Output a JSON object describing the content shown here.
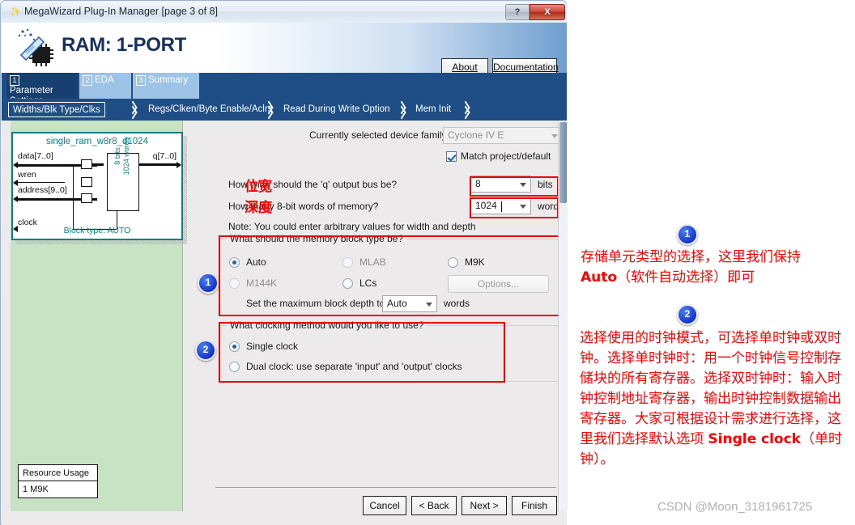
{
  "window": {
    "title": "MegaWizard Plug-In Manager [page 3 of 8]",
    "title_icon": "wand-icon",
    "help_label": "?",
    "close_label": "X"
  },
  "header": {
    "title": "RAM: 1-PORT",
    "logo_icon": "chip-wizard-icon",
    "about_label": "About",
    "documentation_label": "Documentation"
  },
  "tabs": [
    {
      "num": "1",
      "label": "Parameter Settings",
      "active": true
    },
    {
      "num": "2",
      "label": "EDA",
      "active": false
    },
    {
      "num": "3",
      "label": "Summary",
      "active": false
    }
  ],
  "breadcrumbs": [
    {
      "label": "Widths/Blk Type/Clks",
      "selected": true
    },
    {
      "label": "Regs/Clken/Byte Enable/Aclrs",
      "selected": false
    },
    {
      "label": "Read During Write Option",
      "selected": false
    },
    {
      "label": "Mem Init",
      "selected": false
    }
  ],
  "diagram": {
    "title": "single_ram_w8r8_d1024",
    "inputs": [
      "data[7..0]",
      "wren",
      "address[9..0]",
      "clock"
    ],
    "output": "q[7..0]",
    "core_text": "8 bits\n1024 words",
    "block_type": "Block type: AUTO"
  },
  "resource_usage": {
    "header": "Resource Usage",
    "value": "1 M9K"
  },
  "form": {
    "device_family_label": "Currently selected device family:",
    "device_family_value": "Cyclone IV E",
    "match_project_label": "Match project/default",
    "match_project_checked": true,
    "q_width_label": "How wide should the 'q' output bus be?",
    "q_width_value": "8",
    "q_width_unit": "bits",
    "depth_label": "How many 8-bit words of memory?",
    "depth_value": "1024",
    "depth_unit": "words",
    "note": "Note: You could enter arbitrary values for width and depth"
  },
  "block_type_group": {
    "title": "What should the memory block type be?",
    "options": [
      {
        "label": "Auto",
        "selected": true,
        "enabled": true
      },
      {
        "label": "MLAB",
        "selected": false,
        "enabled": false
      },
      {
        "label": "M9K",
        "selected": false,
        "enabled": true
      },
      {
        "label": "M144K",
        "selected": false,
        "enabled": false
      },
      {
        "label": "LCs",
        "selected": false,
        "enabled": true
      }
    ],
    "options_button": "Options...",
    "max_depth_label": "Set the maximum block depth to",
    "max_depth_value": "Auto",
    "max_depth_unit": "words"
  },
  "clocking_group": {
    "title": "What clocking method would you like to use?",
    "options": [
      {
        "label": "Single clock",
        "selected": true
      },
      {
        "label": "Dual clock: use separate 'input' and 'output' clocks",
        "selected": false
      }
    ]
  },
  "wizard_buttons": {
    "cancel": "Cancel",
    "back": "< Back",
    "next": "Next >",
    "finish": "Finish"
  },
  "annotations": {
    "width_tag": "位宽",
    "depth_tag": "深度",
    "badge1": "1",
    "badge2": "2",
    "note1_line1": "存储单元类型的选择，这里我们保持",
    "note1_bold": "Auto",
    "note1_line2_rest": "（软件自动选择）即可",
    "note2_part1": "选择使用的时钟模式，可选择单时钟或双时钟。选择单时钟时：用一个时钟信号控制存储块的所有寄存器。选择双时钟时：输入时钟控制地址寄存器，输出时钟控制数据输出寄存器。大家可根据设计需求进行选择，这里我们选择默认选项 ",
    "note2_bold": "Single clock",
    "note2_part2": "（单时钟）。"
  },
  "watermark": "CSDN @Moon_3181961725",
  "colors": {
    "window_header_blue": "#1f4e87",
    "accent_red": "#ff0000",
    "diagram_teal": "#0b7f7f",
    "left_pane_green": "#c8e2c4",
    "badge_blue": "#1434cf"
  }
}
